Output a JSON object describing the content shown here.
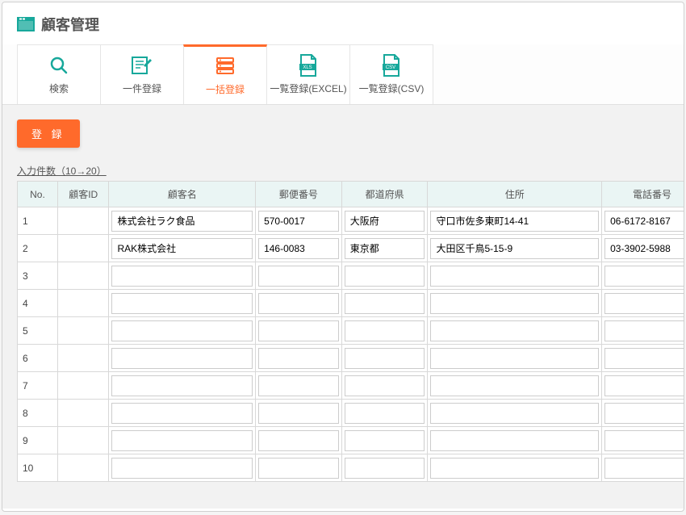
{
  "header": {
    "title": "顧客管理"
  },
  "tabs": [
    {
      "id": "search",
      "label": "検索",
      "active": false
    },
    {
      "id": "single",
      "label": "一件登録",
      "active": false
    },
    {
      "id": "bulk",
      "label": "一括登録",
      "active": true
    },
    {
      "id": "list-xls",
      "label": "一覧登録(EXCEL)",
      "active": false
    },
    {
      "id": "list-csv",
      "label": "一覧登録(CSV)",
      "active": false
    }
  ],
  "register": {
    "label": "登 録"
  },
  "count_link": "入力件数（10→20）",
  "columns": [
    {
      "key": "no",
      "label": "No."
    },
    {
      "key": "id",
      "label": "顧客ID"
    },
    {
      "key": "name",
      "label": "顧客名"
    },
    {
      "key": "postal",
      "label": "郵便番号"
    },
    {
      "key": "pref",
      "label": "都道府県"
    },
    {
      "key": "addr",
      "label": "住所"
    },
    {
      "key": "tel",
      "label": "電話番号"
    }
  ],
  "rows": [
    {
      "no": "1",
      "id": "",
      "name": "株式会社ラク食品",
      "postal": "570-0017",
      "pref": "大阪府",
      "addr": "守口市佐多東町14-41",
      "tel": "06-6172-8167"
    },
    {
      "no": "2",
      "id": "",
      "name": "RAK株式会社",
      "postal": "146-0083",
      "pref": "東京都",
      "addr": "大田区千鳥5-15-9",
      "tel": "03-3902-5988"
    },
    {
      "no": "3",
      "id": "",
      "name": "",
      "postal": "",
      "pref": "",
      "addr": "",
      "tel": ""
    },
    {
      "no": "4",
      "id": "",
      "name": "",
      "postal": "",
      "pref": "",
      "addr": "",
      "tel": ""
    },
    {
      "no": "5",
      "id": "",
      "name": "",
      "postal": "",
      "pref": "",
      "addr": "",
      "tel": ""
    },
    {
      "no": "6",
      "id": "",
      "name": "",
      "postal": "",
      "pref": "",
      "addr": "",
      "tel": ""
    },
    {
      "no": "7",
      "id": "",
      "name": "",
      "postal": "",
      "pref": "",
      "addr": "",
      "tel": ""
    },
    {
      "no": "8",
      "id": "",
      "name": "",
      "postal": "",
      "pref": "",
      "addr": "",
      "tel": ""
    },
    {
      "no": "9",
      "id": "",
      "name": "",
      "postal": "",
      "pref": "",
      "addr": "",
      "tel": ""
    },
    {
      "no": "10",
      "id": "",
      "name": "",
      "postal": "",
      "pref": "",
      "addr": "",
      "tel": ""
    }
  ],
  "colors": {
    "accent": "#17a89b",
    "active": "#ff6a2b"
  }
}
